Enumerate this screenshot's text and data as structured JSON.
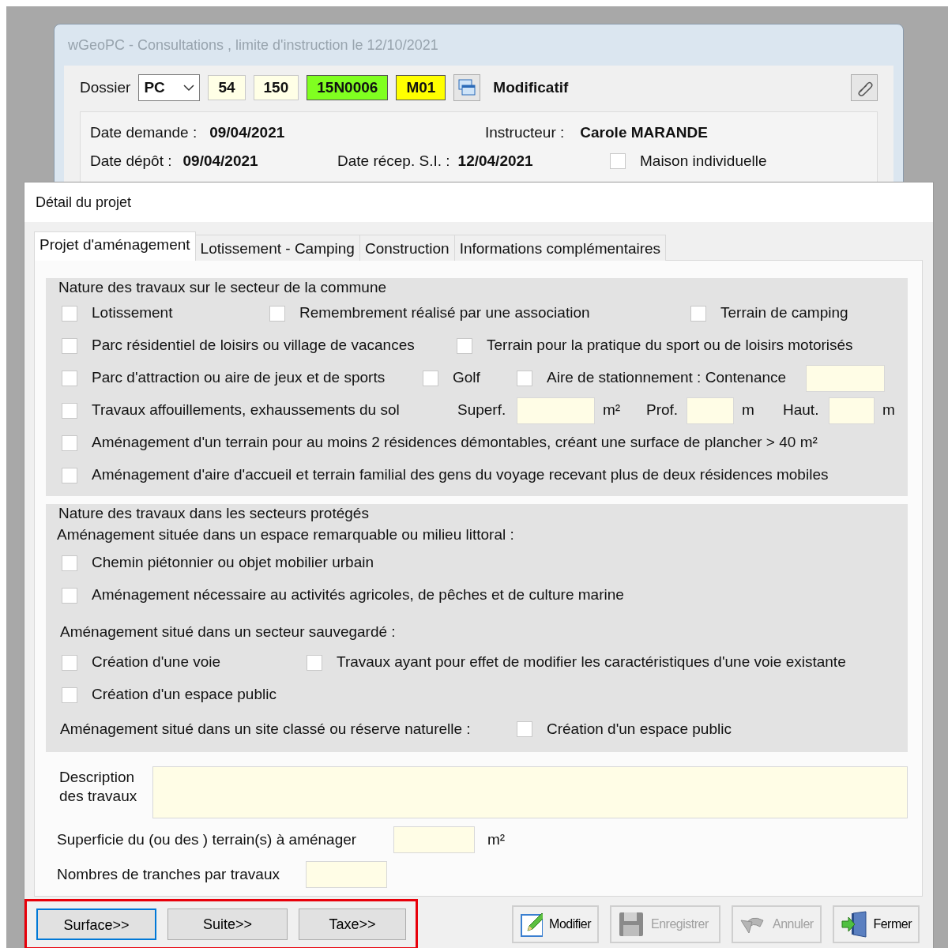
{
  "back_window": {
    "title": "wGeoPC - Consultations , limite d'instruction le 12/10/2021",
    "dossier_label": "Dossier",
    "type_select": "PC",
    "codes": [
      {
        "value": "54",
        "color": "#ffffe6"
      },
      {
        "value": "150",
        "color": "#ffffe6"
      },
      {
        "value": "15N0006",
        "color": "#80ff20"
      },
      {
        "value": "M01",
        "color": "#ffff00"
      }
    ],
    "status": "Modificatif",
    "info": [
      {
        "label": "Date demande :",
        "value": "09/04/2021"
      },
      {
        "label": "Instructeur :",
        "value": "Carole MARANDE"
      },
      {
        "label": "Date dépôt :",
        "value": "09/04/2021"
      },
      {
        "label": "Date récep. S.I. :",
        "value": "12/04/2021"
      }
    ],
    "maison": {
      "label": "Maison individuelle",
      "checked": false
    }
  },
  "dialog": {
    "title": "Détail du projet",
    "tabs": [
      {
        "label": "Projet d'aménagement",
        "selected": true
      },
      {
        "label": "Lotissement - Camping",
        "selected": false
      },
      {
        "label": "Construction",
        "selected": false
      },
      {
        "label": "Informations complémentaires",
        "selected": false
      }
    ],
    "sections": [
      {
        "title": "Nature des travaux sur le secteur de la commune",
        "rows": [
          [
            {
              "kind": "checkbox",
              "label": "Lotissement",
              "checked": false
            },
            {
              "kind": "checkbox",
              "label": "Remembrement réalisé par une association",
              "checked": false
            },
            {
              "kind": "checkbox",
              "label": "Terrain de camping",
              "checked": false
            }
          ],
          [
            {
              "kind": "checkbox",
              "label": "Parc résidentiel de loisirs ou village de vacances",
              "checked": false
            },
            {
              "kind": "checkbox",
              "label": "Terrain pour la pratique du sport ou de loisirs motorisés",
              "checked": false
            }
          ],
          [
            {
              "kind": "checkbox",
              "label": "Parc d'attraction ou aire de jeux et de sports",
              "checked": false
            },
            {
              "kind": "checkbox",
              "label": "Golf",
              "checked": false
            },
            {
              "kind": "checkbox",
              "label": "Aire de stationnement : Contenance",
              "checked": false
            },
            {
              "kind": "input"
            }
          ],
          [
            {
              "kind": "checkbox",
              "label": "Travaux affouillements, exhaussements du sol",
              "checked": false
            },
            {
              "kind": "label",
              "label": "Superf."
            },
            {
              "kind": "input"
            },
            {
              "kind": "label",
              "label": "m²"
            },
            {
              "kind": "label",
              "label": "Prof."
            },
            {
              "kind": "input"
            },
            {
              "kind": "label",
              "label": "m"
            },
            {
              "kind": "label",
              "label": "Haut."
            },
            {
              "kind": "input"
            },
            {
              "kind": "label",
              "label": "m"
            }
          ],
          [
            {
              "kind": "checkbox",
              "label": "Aménagement d'un terrain pour au moins 2 résidences démontables, créant une surface de plancher > 40 m²",
              "checked": false
            }
          ],
          [
            {
              "kind": "checkbox",
              "label": "Aménagement d'aire d'accueil et terrain familial des gens du voyage recevant plus de deux résidences mobiles",
              "checked": false
            }
          ]
        ]
      },
      {
        "title": "Nature des travaux dans les secteurs protégés",
        "rows": [
          [
            {
              "kind": "label",
              "label": "Aménagement située dans un espace remarquable ou milieu littoral :"
            }
          ],
          [
            {
              "kind": "checkbox",
              "label": "Chemin piétonnier ou objet mobilier urbain",
              "checked": false
            }
          ],
          [
            {
              "kind": "checkbox",
              "label": "Aménagement nécessaire au activités agricoles, de pêches et de culture marine",
              "checked": false
            }
          ],
          [
            {
              "kind": "label",
              "label": "Aménagement situé dans un secteur sauvegardé :"
            }
          ],
          [
            {
              "kind": "checkbox",
              "label": "Création d'une voie",
              "checked": false
            },
            {
              "kind": "checkbox",
              "label": "Travaux ayant pour effet de modifier les caractéristiques d'une voie existante",
              "checked": false
            }
          ],
          [
            {
              "kind": "checkbox",
              "label": "Création d'un espace public",
              "checked": false
            }
          ],
          [
            {
              "kind": "label",
              "label": "Aménagement situé dans un site classé ou réserve naturelle :"
            },
            {
              "kind": "checkbox",
              "label": "Création d'un espace public",
              "checked": false
            }
          ]
        ]
      }
    ],
    "description_label": "Description des travaux",
    "superficie": {
      "label": "Superficie du (ou des ) terrain(s) à aménager",
      "unit": "m²"
    },
    "tranches": {
      "label": "Nombres de tranches par travaux"
    },
    "nav_buttons": [
      {
        "label": "Surface>>",
        "default": true
      },
      {
        "label": "Suite>>",
        "default": false
      },
      {
        "label": "Taxe>>",
        "default": false
      }
    ],
    "action_buttons": [
      {
        "label": "Modifier",
        "kind": "edit",
        "disabled": false
      },
      {
        "label": "Enregistrer",
        "kind": "save",
        "disabled": true
      },
      {
        "label": "Annuler",
        "kind": "undo",
        "disabled": true
      },
      {
        "label": "Fermer",
        "kind": "exit",
        "disabled": false
      }
    ]
  }
}
